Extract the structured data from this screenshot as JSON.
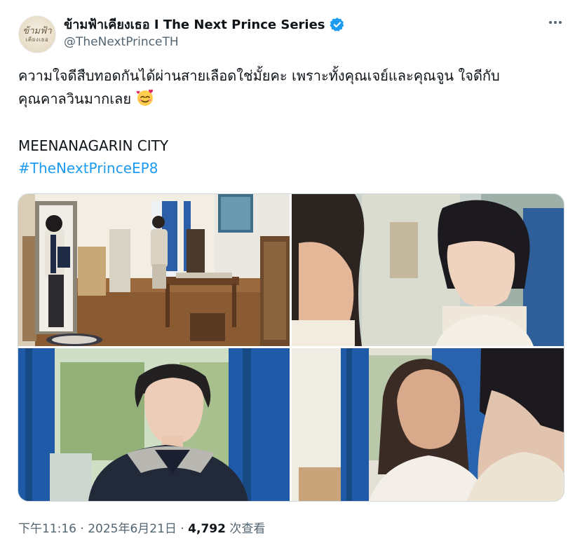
{
  "author": {
    "display_name": "ข้ามฟ้าเคียงเธอ I The Next Prince Series",
    "handle": "@TheNextPrinceTH",
    "verified": true,
    "avatar_text_line1": "ข้ามฟ้า",
    "avatar_text_line2": "เคียงเธอ"
  },
  "icons": {
    "verified": "verified-badge-icon",
    "more": "more-horizontal-icon",
    "emoji": "smiling-face-with-hearts-emoji"
  },
  "tweet": {
    "text_line1": "ความใจดีสืบทอดกันได้ผ่านสายเลือดใช่มั้ยคะ เพราะทั้งคุณเจย์และคุณจูน ใจดีกับ",
    "text_line2": "คุณคาลวินมากเลย",
    "location_text": "MEENANAGARIN CITY",
    "hashtag": "#TheNextPrinceEP8"
  },
  "meta": {
    "time": "下午11:16",
    "separator": "·",
    "date": "2025年6月21日",
    "views_count": "4,792",
    "views_label": "次查看"
  },
  "colors": {
    "accent": "#1d9bf0",
    "text": "#0f1419",
    "secondary": "#536471"
  }
}
